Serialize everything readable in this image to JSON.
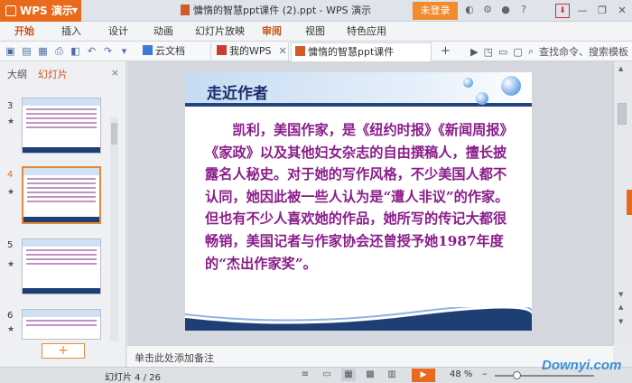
{
  "title_bar": {
    "app_name": "WPS 演示",
    "doc_title": "慵惰的智慧ppt课件 (2).ppt - WPS 演示",
    "login": "未登录"
  },
  "menu": {
    "items": [
      "开始",
      "插入",
      "设计",
      "动画",
      "幻灯片放映",
      "审阅",
      "视图",
      "特色应用"
    ],
    "active": "审阅"
  },
  "tabs": [
    {
      "label": "云文档"
    },
    {
      "label": "我的WPS"
    },
    {
      "label": "慵惰的智慧ppt课件 (2).ppt"
    }
  ],
  "search_label": "查找命令、搜索模板",
  "left_panel": {
    "tab_outline": "大纲",
    "tab_slides": "幻灯片",
    "close": "×",
    "slide_numbers": [
      "3",
      "4",
      "5",
      "6"
    ],
    "star": "★",
    "add": "+"
  },
  "slide": {
    "title": "走近作者",
    "body": "凯利，美国作家，是《纽约时报》《新闻周报》《家政》以及其他妇女杂志的自由撰稿人，擅长披露名人秘史。对于她的写作风格，不少美国人都不认同，她因此被一些人认为是“遭人非议”的作家。但也有不少人喜欢她的作品，她所写的传记大都很畅销，美国记者与作家协会还曾授予她1987年度的“杰出作家奖”。"
  },
  "notes": "单击此处添加备注",
  "status": {
    "page": "幻灯片 4 / 26",
    "zoom": "48 %",
    "zoom_fraction": 0.48
  },
  "watermark": "Downyi.com",
  "colors": {
    "accent": "#e96a1d",
    "slide_text": "#8a1c8a",
    "slide_title": "#1b2c6b",
    "navy": "#24467d"
  }
}
